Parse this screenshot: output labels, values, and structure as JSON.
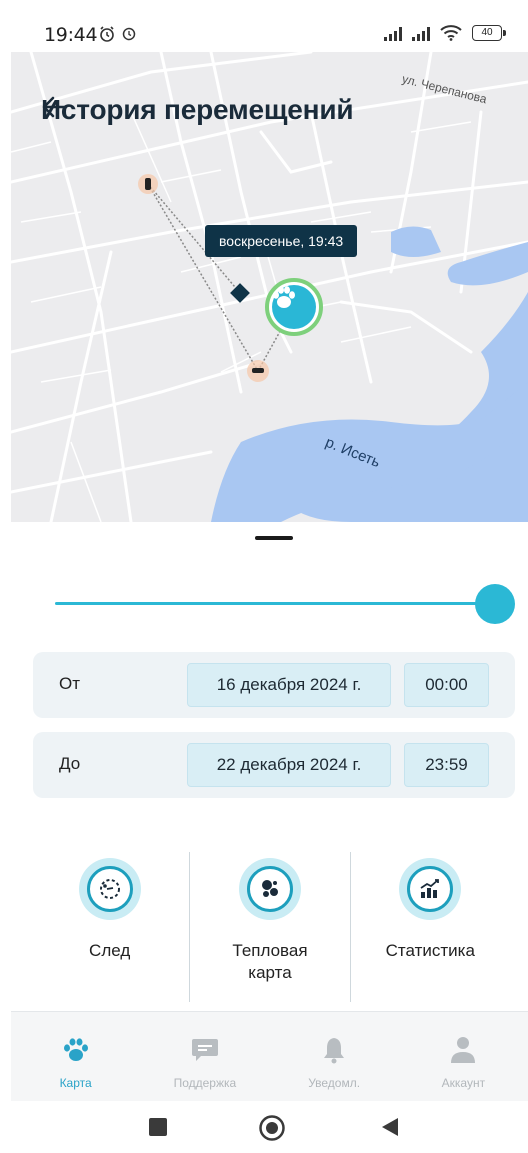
{
  "status_bar": {
    "time": "19:44",
    "battery": "40"
  },
  "map": {
    "title": "История перемещений",
    "street_label": "ул. Черепанова",
    "river_label": "р. Исеть",
    "tooltip": "воскресенье, 19:43"
  },
  "slider": {
    "value_fraction": 1.0
  },
  "range": {
    "from": {
      "label": "От",
      "date": "16 декабря 2024 г.",
      "time": "00:00"
    },
    "to": {
      "label": "До",
      "date": "22 декабря 2024 г.",
      "time": "23:59"
    }
  },
  "modes": [
    {
      "label": "След",
      "icon": "track-icon"
    },
    {
      "label": "Тепловая карта",
      "icon": "heatmap-icon"
    },
    {
      "label": "Статистика",
      "icon": "statistics-icon"
    }
  ],
  "bottom_nav": [
    {
      "label": "Карта",
      "icon": "paw-icon",
      "active": true
    },
    {
      "label": "Поддержка",
      "icon": "chat-icon",
      "active": false
    },
    {
      "label": "Уведомл.",
      "icon": "bell-icon",
      "active": false
    },
    {
      "label": "Аккаунт",
      "icon": "person-icon",
      "active": false
    }
  ],
  "colors": {
    "accent": "#2bb8d5",
    "title": "#1a2b3a",
    "tooltip_bg": "#0f3347",
    "river": "#a9c7f2",
    "marker_ring": "#7ed07c"
  }
}
